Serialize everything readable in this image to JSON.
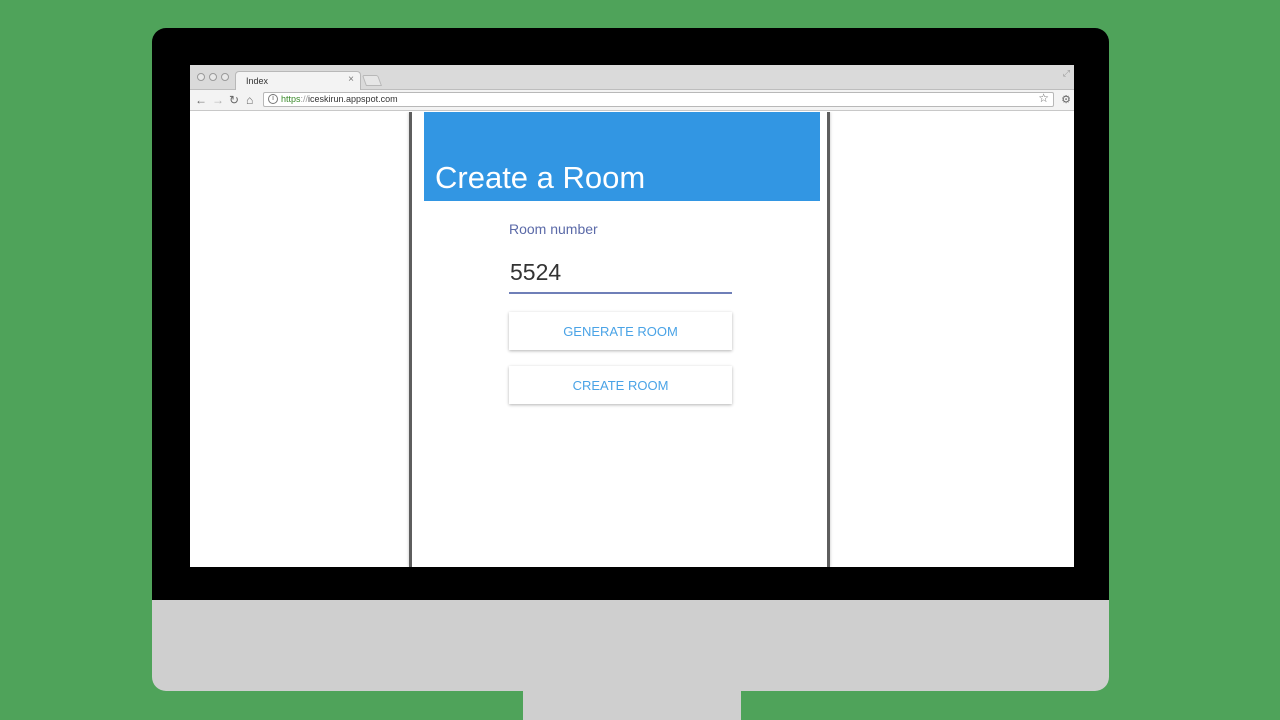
{
  "browser": {
    "tab_title": "Index",
    "tab_close": "×",
    "url_scheme": "https",
    "url_separator": "://",
    "url_host": "iceskirun.appspot.com"
  },
  "page": {
    "title": "Create a Room",
    "room_label": "Room number",
    "room_value": "5524",
    "generate_label": "GENERATE ROOM",
    "create_label": "CREATE ROOM"
  },
  "colors": {
    "background": "#4fa35a",
    "header": "#3296e3",
    "accent_text": "#4aa3e6"
  }
}
